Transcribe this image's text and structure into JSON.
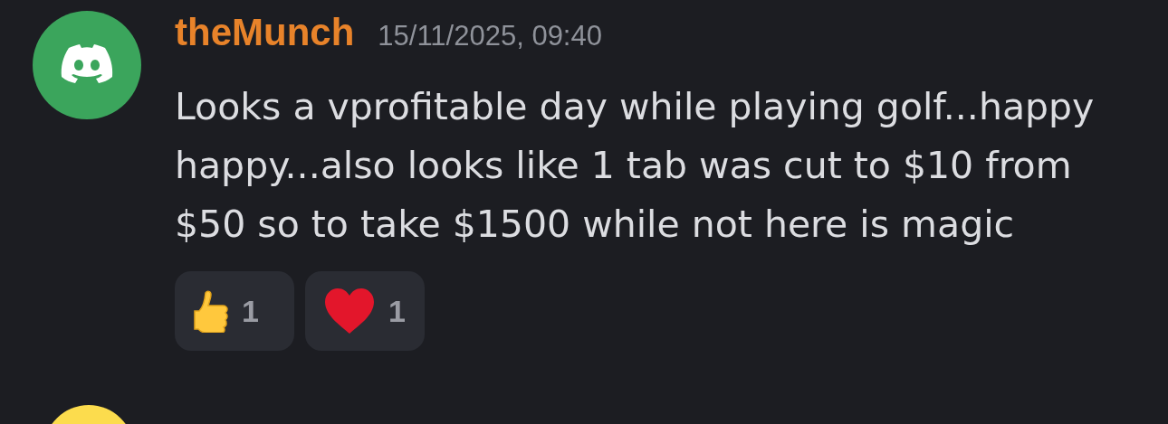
{
  "message": {
    "author": "theMunch",
    "timestamp": "15/11/2025, 09:40",
    "text": "Looks a vprofitable day while playing golf...happy happy...also looks like 1 tab was cut to $10 from $50 so to take $1500 while not here is magic",
    "reactions": [
      {
        "kind": "thumbs-up",
        "count": "1",
        "selected": false
      },
      {
        "kind": "heart",
        "count": "1",
        "selected": false
      }
    ]
  }
}
